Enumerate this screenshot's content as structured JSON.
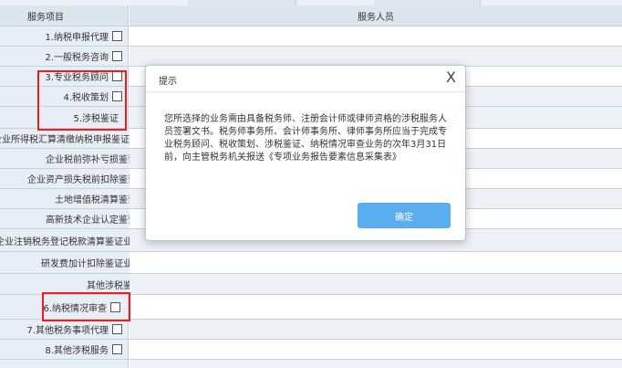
{
  "table": {
    "header_service_item": "服务项目",
    "header_service_staff": "服务人员"
  },
  "rows": [
    {
      "label": "1.纳税申报代理"
    },
    {
      "label": "2.一般税务咨询"
    },
    {
      "label": "3.专业税务顾问"
    },
    {
      "label": "4.税收策划"
    },
    {
      "label": "5.涉税鉴证"
    },
    {
      "label": "企业所得税汇算清缴纳税申报鉴证业务"
    },
    {
      "label": "企业税前弥补亏损鉴证业务"
    },
    {
      "label": "企业资产损失税前扣除鉴证业务"
    },
    {
      "label": "土地增值税清算鉴证业务"
    },
    {
      "label": "高新技术企业认定鉴证业务"
    },
    {
      "label": "企业注销税务登记税款清算鉴证业务"
    },
    {
      "label": "研发费加计扣除鉴证业务"
    },
    {
      "label": "其他涉税鉴证"
    },
    {
      "label": "6.纳税情况审查"
    },
    {
      "label": "7.其他税务事项代理"
    },
    {
      "label": "8.其他涉税服务"
    }
  ],
  "dialog": {
    "title": "提示",
    "close": "X",
    "message": "您所选择的业务需由具备税务师、注册会计师或律师资格的涉税服务人员签署文书。税务师事务所、会计师事务所、律师事务所应当于完成专业税务顾问、税收策划、涉税鉴证、纳税情况审查业务的次年3月31日前，向主管税务机关报送《专项业务报告要素信息采集表》",
    "confirm": "确定"
  }
}
